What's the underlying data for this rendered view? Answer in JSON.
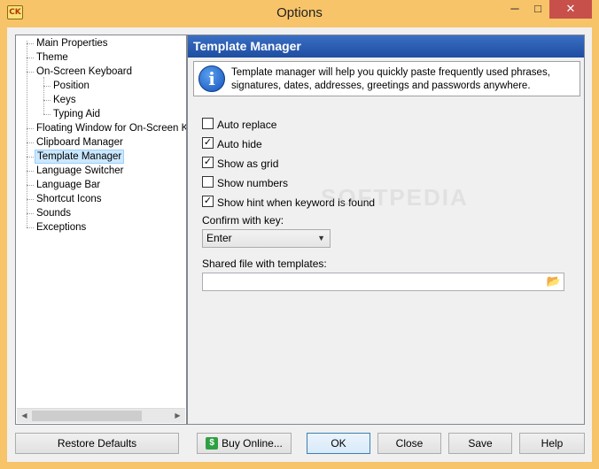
{
  "window": {
    "title": "Options",
    "app_icon_text": "CK",
    "minimize_glyph": "─",
    "maximize_glyph": "□",
    "close_glyph": "✕"
  },
  "tree": {
    "items": [
      {
        "label": "Main Properties",
        "level": 0
      },
      {
        "label": "Theme",
        "level": 0
      },
      {
        "label": "On-Screen Keyboard",
        "level": 0
      },
      {
        "label": "Position",
        "level": 1
      },
      {
        "label": "Keys",
        "level": 1
      },
      {
        "label": "Typing Aid",
        "level": 1
      },
      {
        "label": "Floating Window for On-Screen Ke",
        "level": 0
      },
      {
        "label": "Clipboard Manager",
        "level": 0
      },
      {
        "label": "Template Manager",
        "level": 0,
        "selected": true
      },
      {
        "label": "Language Switcher",
        "level": 0
      },
      {
        "label": "Language Bar",
        "level": 0
      },
      {
        "label": "Shortcut Icons",
        "level": 0
      },
      {
        "label": "Sounds",
        "level": 0
      },
      {
        "label": "Exceptions",
        "level": 0
      }
    ]
  },
  "panel": {
    "title": "Template Manager",
    "info_text": "Template manager will help you quickly paste frequently used phrases, signatures, dates, addresses, greetings and passwords anywhere.",
    "checkboxes": [
      {
        "label": "Auto replace",
        "checked": false
      },
      {
        "label": "Auto hide",
        "checked": true
      },
      {
        "label": "Show as grid",
        "checked": true
      },
      {
        "label": "Show numbers",
        "checked": false
      },
      {
        "label": "Show hint when keyword is found",
        "checked": true
      }
    ],
    "confirm_label": "Confirm with key:",
    "confirm_value": "Enter",
    "shared_file_label": "Shared file with templates:",
    "shared_file_value": "",
    "watermark": "SOFTPEDIA"
  },
  "buttons": {
    "restore": "Restore Defaults",
    "buy": "Buy Online...",
    "ok": "OK",
    "close": "Close",
    "save": "Save",
    "help": "Help"
  },
  "colors": {
    "title_bar": "#f7c46a",
    "header_blue": "#1e4da1",
    "selection": "#cce8ff",
    "close_button": "#c7504a"
  }
}
